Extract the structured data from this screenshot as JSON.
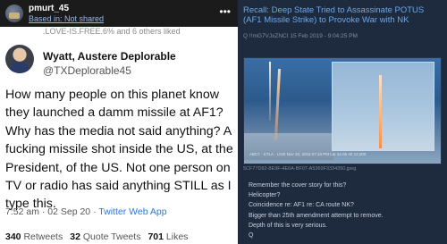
{
  "left": {
    "topbar": {
      "username": "pmurt_45",
      "subtitle": "Based in: Not shared",
      "more": "•••"
    },
    "liked_line": ".LOVE-IS.FREE.6% and 6 others liked",
    "tweet": {
      "name": "Wyatt, Austere Deplorable",
      "handle": "@TXDeplorable45",
      "text": "How many people on this planet know they launched a damm missile at AF1? Why has the media not said anything? A fucking missile shot inside the US, at the President, of the US. Not one person on TV or radio has said anything STILL as I type this.",
      "time": "7:52 am · 02 Sep 20 · ",
      "app": "Twitter Web App",
      "retweets_count": "340",
      "retweets_label": "Retweets",
      "quotes_count": "32",
      "quotes_label": "Quote Tweets",
      "likes_count": "701",
      "likes_label": "Likes"
    }
  },
  "right": {
    "title": "Recall: Deep State Tried to Assassinate POTUS (AF1 Missile Strike) to Provoke War with NK",
    "meta": "Q  !!mG7VJxZNCI  15 Feb 2019 - 9:04:25 PM",
    "image_ticker": "ABC7 · KTLA · LIVE   Nov 10, 2015   07:15 PM   Lat 34.06   Alt 12,000",
    "filename": "5CF77D82-8E9F-4E6A-BF07-A5369F3334350.jpeg",
    "body": [
      "Remember the cover story for this?",
      "Helicopter?",
      "Coincidence re: AF1 re: CA route NK?",
      "Bigger than 25th amendment attempt to remove.",
      "Depth of this is very serious.",
      "Q"
    ]
  },
  "colors": {
    "link_blue": "#2a7ad8",
    "right_bg": "#1e2a3d",
    "title_blue": "#6fa7e6"
  }
}
